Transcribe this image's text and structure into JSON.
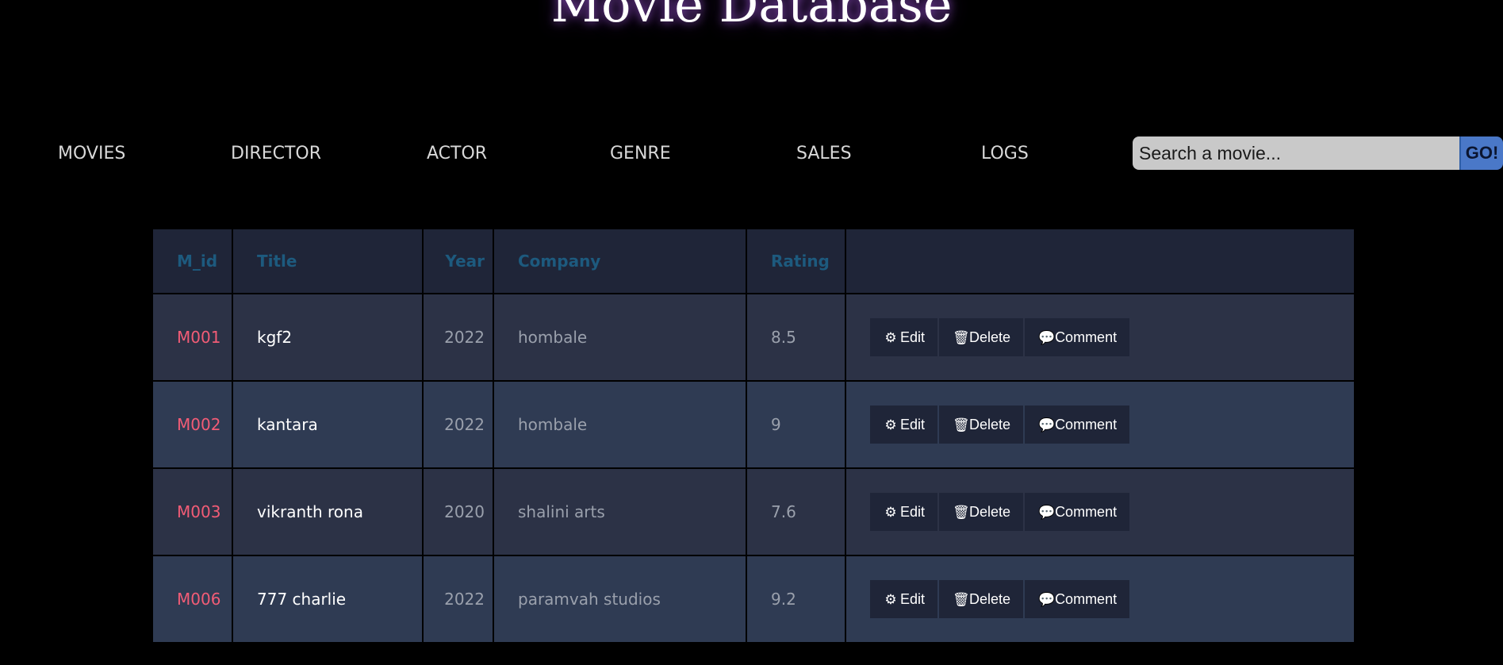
{
  "header": {
    "title": "Movie Database"
  },
  "nav": {
    "items": [
      {
        "label": "MOVIES"
      },
      {
        "label": "DIRECTOR"
      },
      {
        "label": "ACTOR"
      },
      {
        "label": "GENRE"
      },
      {
        "label": "SALES"
      },
      {
        "label": "LOGS"
      }
    ]
  },
  "search": {
    "placeholder": "Search a movie...",
    "value": "",
    "button_label": "GO!"
  },
  "table": {
    "columns": [
      "M_id",
      "Title",
      "Year",
      "Company",
      "Rating",
      ""
    ],
    "rows": [
      {
        "id": "M001",
        "title": "kgf2",
        "year": "2022",
        "company": "hombale",
        "rating": "8.5"
      },
      {
        "id": "M002",
        "title": "kantara",
        "year": "2022",
        "company": "hombale",
        "rating": "9"
      },
      {
        "id": "M003",
        "title": "vikranth rona",
        "year": "2020",
        "company": "shalini arts",
        "rating": "7.6"
      },
      {
        "id": "M006",
        "title": "777 charlie",
        "year": "2022",
        "company": "paramvah studios",
        "rating": "9.2"
      }
    ],
    "actions": {
      "edit_label": "Edit",
      "delete_label": "Delete",
      "comment_label": "Comment",
      "edit_icon": "gear-icon",
      "delete_icon": "trash-icon",
      "comment_icon": "speech-bubble-icon"
    }
  },
  "colors": {
    "background": "#000000",
    "header_text": "#1d5a7e",
    "id_text": "#f25c76",
    "go_button": "#4a78c8",
    "title_glow": "#be6eff"
  }
}
